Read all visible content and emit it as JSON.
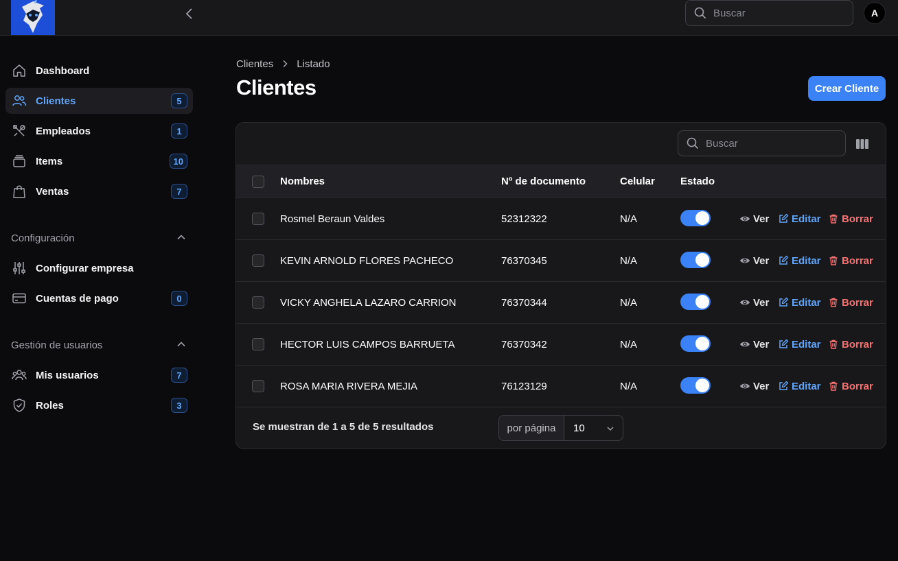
{
  "topbar": {
    "search_placeholder": "Buscar",
    "avatar_initial": "A"
  },
  "sidebar": {
    "items": [
      {
        "label": "Dashboard",
        "icon": "home-icon",
        "badge": null,
        "active": false
      },
      {
        "label": "Clientes",
        "icon": "users-icon",
        "badge": "5",
        "active": true
      },
      {
        "label": "Empleados",
        "icon": "tools-icon",
        "badge": "1",
        "active": false
      },
      {
        "label": "Items",
        "icon": "box-icon",
        "badge": "10",
        "active": false
      },
      {
        "label": "Ventas",
        "icon": "shopping-bag-icon",
        "badge": "7",
        "active": false
      }
    ],
    "groups": [
      {
        "title": "Configuración",
        "items": [
          {
            "label": "Configurar empresa",
            "icon": "sliders-icon",
            "badge": null
          },
          {
            "label": "Cuentas de pago",
            "icon": "credit-card-icon",
            "badge": "0"
          }
        ]
      },
      {
        "title": "Gestión de usuarios",
        "items": [
          {
            "label": "Mis usuarios",
            "icon": "user-group-icon",
            "badge": "7"
          },
          {
            "label": "Roles",
            "icon": "shield-check-icon",
            "badge": "3"
          }
        ]
      }
    ]
  },
  "breadcrumb": {
    "parent": "Clientes",
    "current": "Listado"
  },
  "page": {
    "title": "Clientes",
    "create_label": "Crear Cliente"
  },
  "table": {
    "search_placeholder": "Buscar",
    "columns": {
      "name": "Nombres",
      "document": "Nº de documento",
      "phone": "Celular",
      "status": "Estado"
    },
    "actions": {
      "view": "Ver",
      "edit": "Editar",
      "delete": "Borrar"
    },
    "rows": [
      {
        "name": "Rosmel Beraun Valdes",
        "document": "52312322",
        "phone": "N/A",
        "active": true
      },
      {
        "name": "KEVIN ARNOLD FLORES PACHECO",
        "document": "76370345",
        "phone": "N/A",
        "active": true
      },
      {
        "name": "VICKY ANGHELA LAZARO CARRION",
        "document": "76370344",
        "phone": "N/A",
        "active": true
      },
      {
        "name": "HECTOR LUIS CAMPOS BARRUETA",
        "document": "76370342",
        "phone": "N/A",
        "active": true
      },
      {
        "name": "ROSA MARIA RIVERA MEJIA",
        "document": "76123129",
        "phone": "N/A",
        "active": true
      }
    ],
    "footer_text": "Se muestran de 1 a 5 de 5 resultados",
    "per_page_label": "por página",
    "per_page_value": "10"
  },
  "colors": {
    "accent": "#3b82f6",
    "accent_text": "#60a5fa",
    "danger": "#f87171",
    "background": "#0b0b0e",
    "surface": "#18181b"
  }
}
